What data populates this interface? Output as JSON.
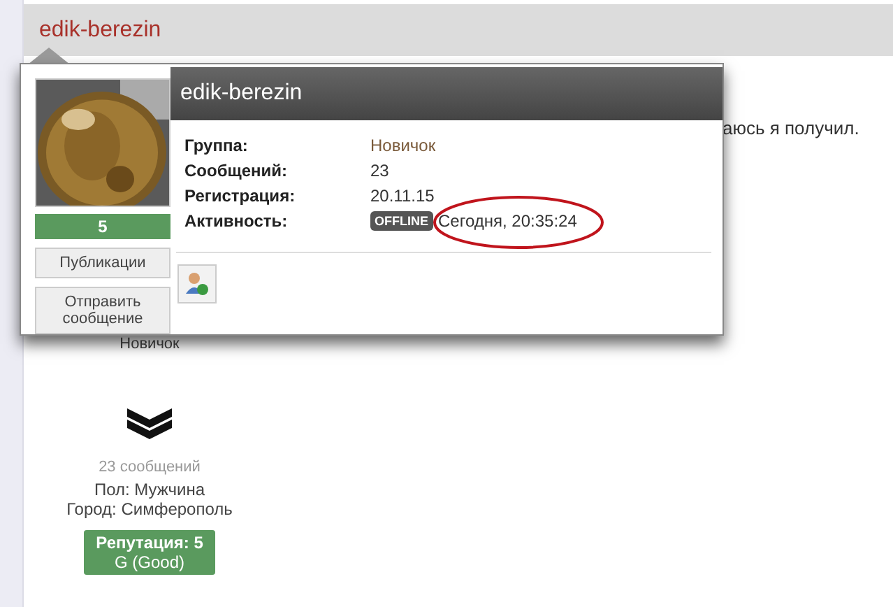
{
  "header": {
    "username": "edik-berezin"
  },
  "post": {
    "text_fragment": "аюсь я получил."
  },
  "author": {
    "group": "Новичок",
    "posts": "23 сообщений",
    "gender": "Пол: Мужчина",
    "city": "Город: Симферополь",
    "reputation": "Репутация: 5",
    "reputation_grade": "G (Good)"
  },
  "popup": {
    "name": "edik-berezin",
    "reputation": "5",
    "buttons": [
      "Публикации",
      "Отправить сообщение"
    ],
    "fields": [
      {
        "label": "Группа:",
        "value": "Новичок",
        "kind": "link"
      },
      {
        "label": "Сообщений:",
        "value": "23",
        "kind": "text"
      },
      {
        "label": "Регистрация:",
        "value": "20.11.15",
        "kind": "text"
      },
      {
        "label": "Активность:",
        "value": "Сегодня, 20:35:24",
        "kind": "status",
        "badge": "OFFLINE"
      }
    ]
  }
}
